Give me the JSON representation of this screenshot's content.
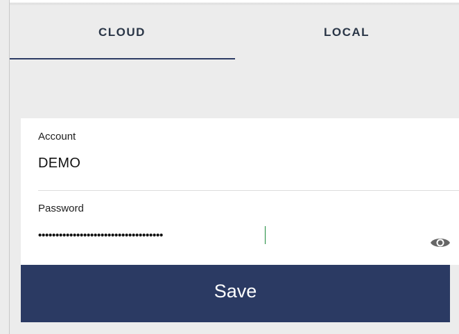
{
  "tabs": [
    {
      "label": "CLOUD",
      "selected": true
    },
    {
      "label": "LOCAL",
      "selected": false
    }
  ],
  "form": {
    "account": {
      "label": "Account",
      "value": "DEMO"
    },
    "password": {
      "label": "Password",
      "masked_value": "••••••••••••••••••••••••••••••••••••",
      "toggle_icon": "eye-icon"
    }
  },
  "save_button": {
    "label": "Save"
  },
  "colors": {
    "accent": "#2b3a63",
    "background": "#ececec",
    "card": "#ffffff",
    "cursor": "#1b8a3a"
  }
}
